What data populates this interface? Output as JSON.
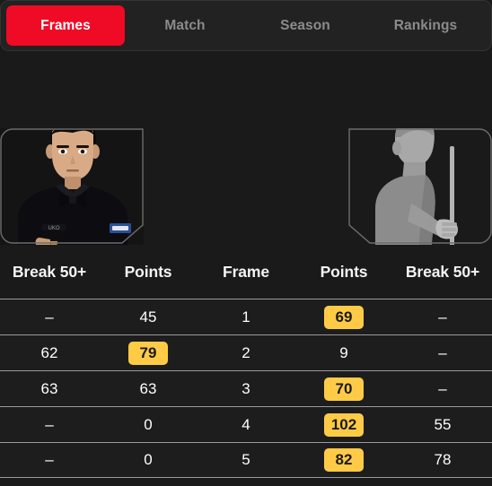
{
  "tabs": [
    {
      "label": "Frames",
      "active": true
    },
    {
      "label": "Match",
      "active": false
    },
    {
      "label": "Season",
      "active": false
    },
    {
      "label": "Rankings",
      "active": false
    }
  ],
  "players": {
    "left": {
      "avatar_type": "photo",
      "alt": "left-player-photo"
    },
    "right": {
      "avatar_type": "silhouette",
      "alt": "right-player-silhouette-placeholder"
    }
  },
  "table": {
    "headers": [
      "Break 50+",
      "Points",
      "Frame",
      "Points",
      "Break 50+"
    ],
    "rows": [
      {
        "left_break": "–",
        "left_points": "45",
        "left_points_highlight": false,
        "frame": "1",
        "right_points": "69",
        "right_points_highlight": true,
        "right_break": "–"
      },
      {
        "left_break": "62",
        "left_points": "79",
        "left_points_highlight": true,
        "frame": "2",
        "right_points": "9",
        "right_points_highlight": false,
        "right_break": "–"
      },
      {
        "left_break": "63",
        "left_points": "63",
        "left_points_highlight": false,
        "frame": "3",
        "right_points": "70",
        "right_points_highlight": true,
        "right_break": "–"
      },
      {
        "left_break": "–",
        "left_points": "0",
        "left_points_highlight": false,
        "frame": "4",
        "right_points": "102",
        "right_points_highlight": true,
        "right_break": "55"
      },
      {
        "left_break": "–",
        "left_points": "0",
        "left_points_highlight": false,
        "frame": "5",
        "right_points": "82",
        "right_points_highlight": true,
        "right_break": "78"
      }
    ]
  },
  "colors": {
    "background": "#1a1a1a",
    "tabbar_background": "#222223",
    "active_tab": "#ef0a26",
    "highlight_badge": "#ffcb47",
    "row_divider": "#9a9a9a",
    "inactive_tab_text": "#8b8b8c"
  }
}
